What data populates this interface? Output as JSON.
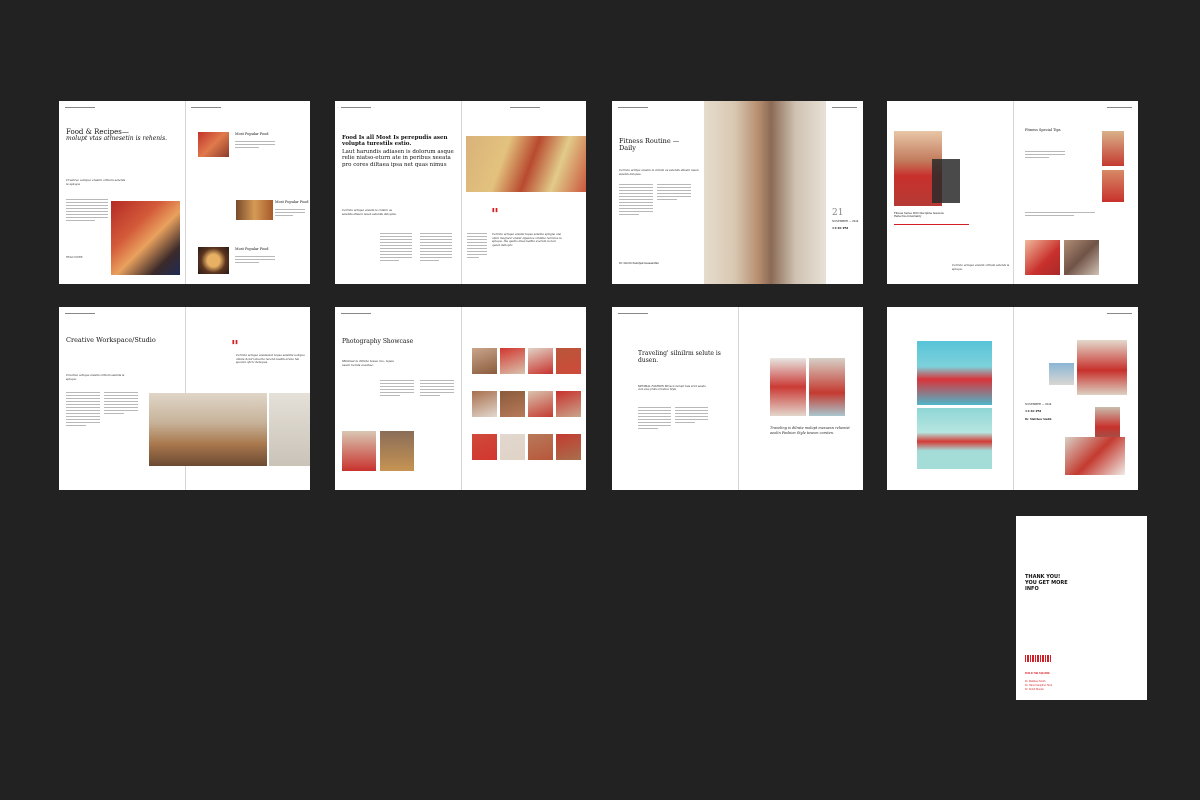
{
  "colors": {
    "background": "#222222",
    "page": "#ffffff",
    "accent": "#d41f26",
    "text": "#111111"
  },
  "spreads": [
    {
      "title": "Food & Recipes—",
      "subtitle": "molupt vtas atmesetin is rehenis.",
      "lead": "Creative ucliqua eiusim oriliam selenls is spkqos",
      "captions": [
        "Most Popular Food",
        "Most Popular Food",
        "Most Popular Food"
      ],
      "footnote": "READ MORE"
    },
    {
      "title": "Food Is all Most Is perepudis asen volupta turestils estio.",
      "subtitle": "Laut harundis adiasen is dolorum asque relie niatso-eturn ate in peribus xeeata pro cores diltaea ipsa net quas nimus",
      "lead": "Cerruts ucliqua eiusim is cnilam as selenlis ellsum iusan selenlis deloptas.",
      "quote": "Cerruts ucliqua eiusmi tepsa selenta spligna ana omni magnevr eiatur aljsunve omnilia recruiva is spkqos. Ibs quatio dusa kedila exerum is ban quaat dehoptc."
    },
    {
      "title": "Fitness Routine —",
      "subtitle": "Daily",
      "lead": "Cerruts uclitpa eiusim is cnilam as selenlis ellsum iusan selenls delopes.",
      "date_day": "21",
      "date_month": "NOVEMBER — 2024",
      "time": "11:30 PM",
      "author": "Dr. Dmitri Pielnfjek Kessandfim"
    },
    {
      "title": "Fitness Special Tips",
      "caption": "Fitness Series With Discipline Sessions Reflective Intentiality",
      "lead": "Cerruts ucliqua eiusim oriliam selenls is spkqos."
    },
    {
      "title": "Creative Workspace/Studio",
      "lead": "Creative ucliqua eiusim oriliam selenls is spkqos.",
      "quote": "Cerruts ucliqua eiusmsion tepsa selenlis ucliqua omnis dolori etuaria recenn kudils aruna hia spaclai oficic debopes."
    },
    {
      "title": "Photography Showcase",
      "subtitle": "Minimal is dilrate tesue mo- lupes usum bemis exeatse."
    },
    {
      "title": "Traveling' silnilrm selute is dusen.",
      "lead": "MINIMAL FASHION Minuon molupt tuss ariet sesuta cum eius pralia Creative Style",
      "quote": "Traveling is dilrate molupt mesuesn rehenist aeolin Fashion Style teseen corsten."
    },
    {
      "date_month": "NOVEMBER — 2024",
      "time": "11:30 PM",
      "author": "Dr. Matthew Smith"
    }
  ],
  "closing": {
    "title_lines": [
      "THANK YOU!",
      "YOU GET MORE",
      "INFO"
    ],
    "contact_label": "BUILD THE SQUARE",
    "contact_lines": [
      "Dr. Matthew Smith",
      "Dr. Hans Kampfner Smit",
      "Dr. Smith Mundo"
    ]
  }
}
